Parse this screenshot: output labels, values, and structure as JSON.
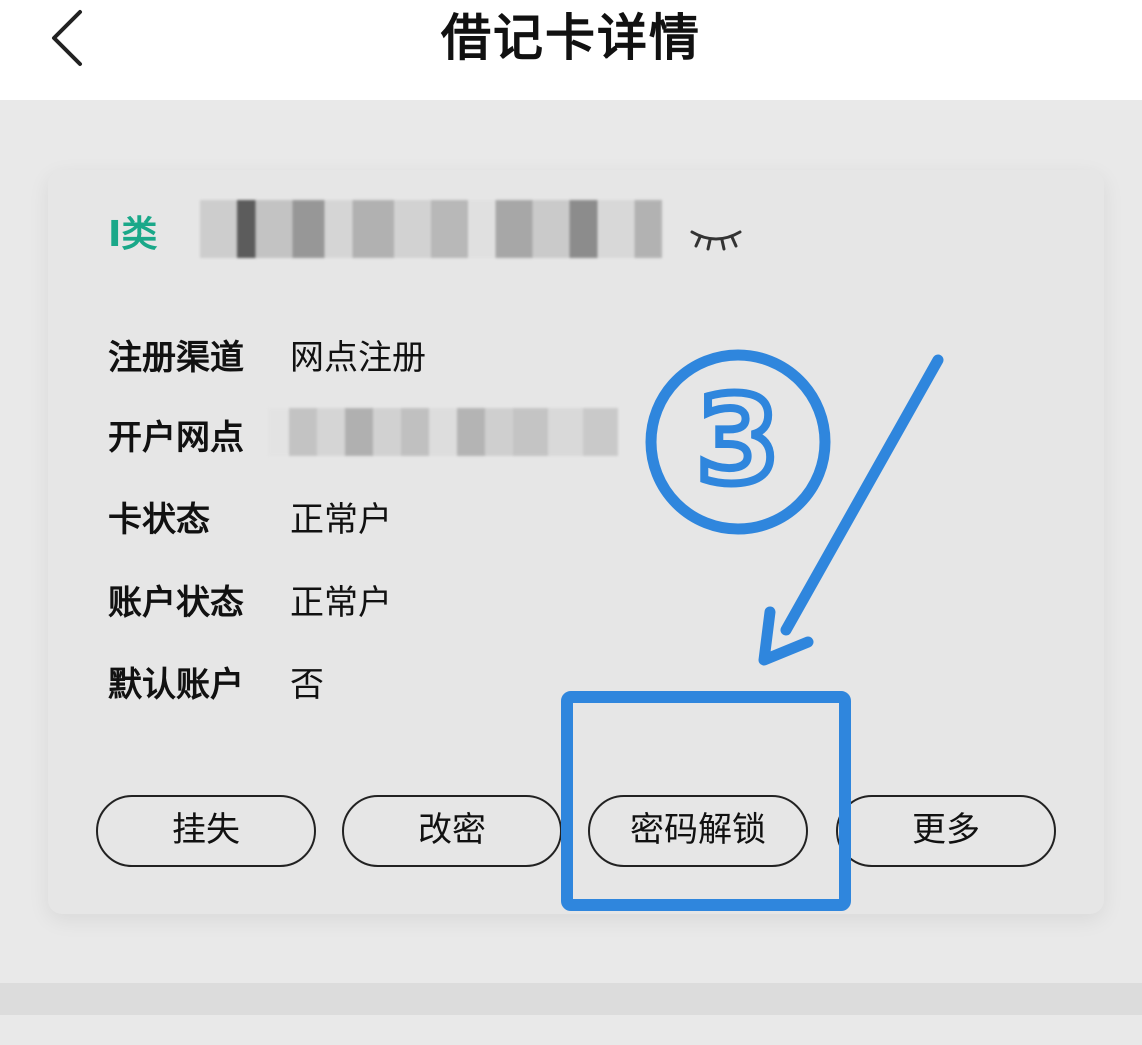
{
  "header": {
    "title": "借记卡详情"
  },
  "card": {
    "tag": "I类",
    "fields": [
      {
        "label": "注册渠道",
        "value": "网点注册"
      },
      {
        "label": "开户网点",
        "value": ""
      },
      {
        "label": "卡状态",
        "value": "正常户"
      },
      {
        "label": "账户状态",
        "value": "正常户"
      },
      {
        "label": "默认账户",
        "value": "否"
      }
    ],
    "buttons": [
      "挂失",
      "改密",
      "密码解锁",
      "更多"
    ]
  },
  "annotation": {
    "step_number": "3",
    "color": "#2f86dd"
  }
}
